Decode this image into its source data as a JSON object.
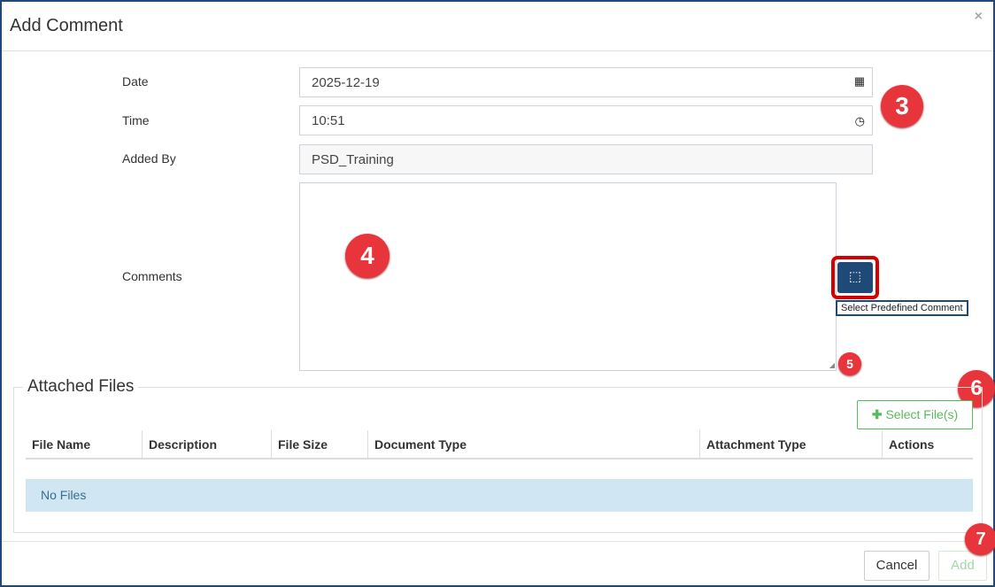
{
  "dialog": {
    "title": "Add Comment",
    "close": "×"
  },
  "form": {
    "date_label": "Date",
    "date_value": "2025-12-19",
    "time_label": "Time",
    "time_value": "10:51",
    "added_by_label": "Added By",
    "added_by_value": "PSD_Training",
    "comments_label": "Comments",
    "comments_value": "",
    "predefined_tooltip": "Select Predefined Comment"
  },
  "attached": {
    "legend": "Attached Files",
    "select_button": "Select File(s)",
    "columns": [
      "File Name",
      "Description",
      "File Size",
      "Document Type",
      "Attachment Type",
      "Actions"
    ],
    "empty": "No Files"
  },
  "footer": {
    "cancel": "Cancel",
    "add": "Add"
  },
  "badges": [
    "3",
    "4",
    "5",
    "6",
    "7"
  ],
  "colors": {
    "accent": "#1f4a78",
    "badge": "#e8343b",
    "success": "#5cb85c",
    "info_bg": "#d0e6f3"
  }
}
